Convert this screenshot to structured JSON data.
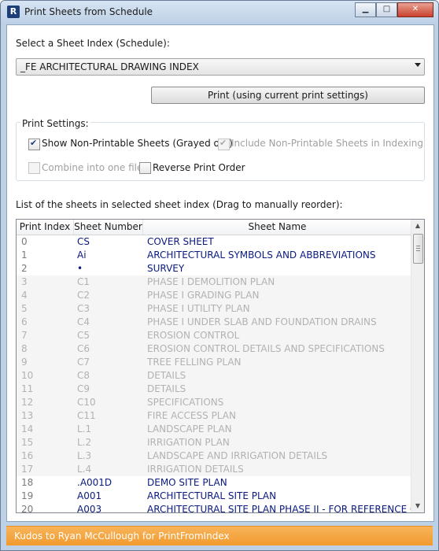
{
  "window": {
    "title": "Print Sheets from Schedule",
    "app_icon": "revit-icon",
    "controls": {
      "minimize": "minimize-icon",
      "maximize": "maximize-icon",
      "close": "close-icon"
    }
  },
  "schedule": {
    "label": "Select a Sheet Index (Schedule):",
    "selected": "_FE ARCHITECTURAL DRAWING INDEX"
  },
  "print_button": "Print (using current print settings)",
  "print_settings": {
    "title": "Print Settings:",
    "show_non_printable": {
      "label": "Show Non-Printable Sheets (Grayed out)",
      "checked": true,
      "enabled": true
    },
    "include_non_printable": {
      "label": "Include Non-Printable Sheets in Indexing",
      "checked": true,
      "enabled": false
    },
    "combine": {
      "label": "Combine into one file",
      "checked": false,
      "enabled": false
    },
    "reverse": {
      "label": "Reverse Print Order",
      "checked": false,
      "enabled": true
    }
  },
  "list": {
    "label": "List of the sheets in selected sheet index (Drag to manually reorder):",
    "columns": [
      "Print Index",
      "Sheet Number",
      "Sheet Name"
    ],
    "rows": [
      {
        "idx": "0",
        "num": "CS",
        "name": "COVER SHEET",
        "printable": true
      },
      {
        "idx": "1",
        "num": "Ai",
        "name": "ARCHITECTURAL SYMBOLS AND ABBREVIATIONS",
        "printable": true
      },
      {
        "idx": "2",
        "num": "•",
        "name": "SURVEY",
        "printable": true
      },
      {
        "idx": "3",
        "num": "C1",
        "name": "PHASE I DEMOLITION PLAN",
        "printable": false
      },
      {
        "idx": "4",
        "num": "C2",
        "name": "PHASE I GRADING PLAN",
        "printable": false
      },
      {
        "idx": "5",
        "num": "C3",
        "name": "PHASE I UTILITY PLAN",
        "printable": false
      },
      {
        "idx": "6",
        "num": "C4",
        "name": "PHASE I UNDER SLAB AND FOUNDATION DRAINS",
        "printable": false
      },
      {
        "idx": "7",
        "num": "C5",
        "name": "EROSION CONTROL",
        "printable": false
      },
      {
        "idx": "8",
        "num": "C6",
        "name": "EROSION CONTROL DETAILS AND SPECIFICATIONS",
        "printable": false
      },
      {
        "idx": "9",
        "num": "C7",
        "name": "TREE FELLING PLAN",
        "printable": false
      },
      {
        "idx": "10",
        "num": "C8",
        "name": "DETAILS",
        "printable": false
      },
      {
        "idx": "11",
        "num": "C9",
        "name": "DETAILS",
        "printable": false
      },
      {
        "idx": "12",
        "num": "C10",
        "name": "SPECIFICATIONS",
        "printable": false
      },
      {
        "idx": "13",
        "num": "C11",
        "name": "FIRE ACCESS PLAN",
        "printable": false
      },
      {
        "idx": "14",
        "num": "L.1",
        "name": "LANDSCAPE PLAN",
        "printable": false
      },
      {
        "idx": "15",
        "num": "L.2",
        "name": "IRRIGATION PLAN",
        "printable": false
      },
      {
        "idx": "16",
        "num": "L.3",
        "name": "LANDSCAPE AND IRRIGATION DETAILS",
        "printable": false
      },
      {
        "idx": "17",
        "num": "L.4",
        "name": "IRRIGATION DETAILS",
        "printable": false
      },
      {
        "idx": "18",
        "num": ".A001D",
        "name": "DEMO SITE PLAN",
        "printable": true
      },
      {
        "idx": "19",
        "num": "A001",
        "name": "ARCHITECTURAL SITE PLAN",
        "printable": true
      },
      {
        "idx": "20",
        "num": "A003",
        "name": "ARCHITECTURAL SITE PLAN PHASE II - FOR REFERENCE ONLY",
        "printable": true
      }
    ]
  },
  "footer": {
    "text": "Kudos to Ryan McCullough for PrintFromIndex",
    "color": "#f29a2e"
  }
}
